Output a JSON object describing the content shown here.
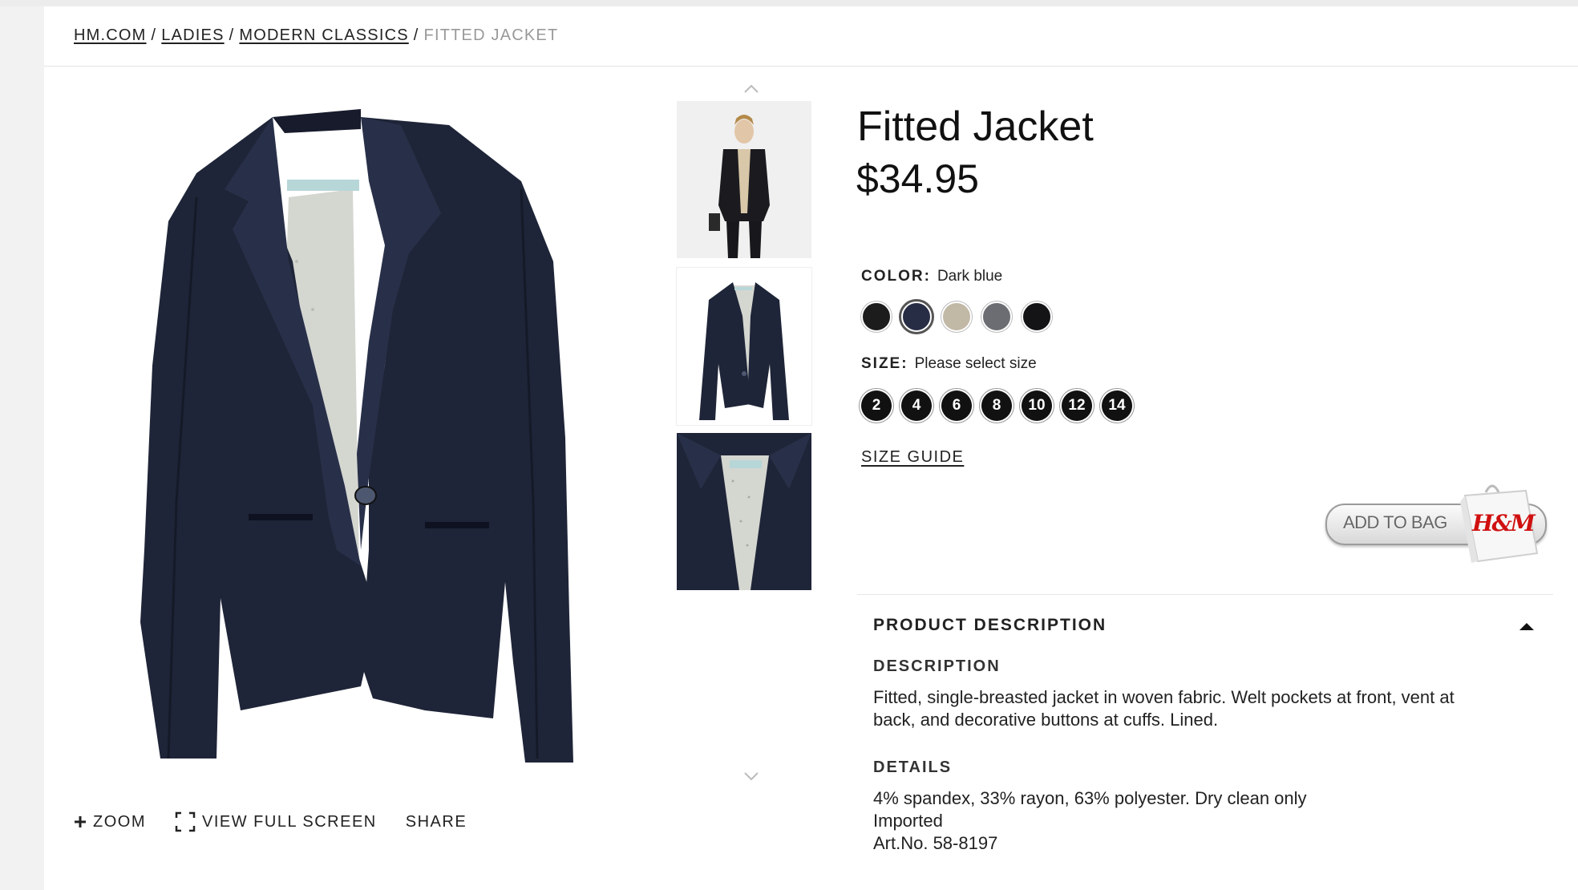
{
  "breadcrumb": {
    "items": [
      "HM.COM",
      "LADIES",
      "MODERN CLASSICS"
    ],
    "separator": "/",
    "current": "FITTED JACKET"
  },
  "image_actions": {
    "zoom": "ZOOM",
    "full_screen": "VIEW FULL SCREEN",
    "share": "SHARE"
  },
  "product": {
    "title": "Fitted Jacket",
    "price": "$34.95"
  },
  "color": {
    "label": "COLOR:",
    "selected": "Dark blue",
    "swatches": [
      {
        "name": "black",
        "hex": "#1c1c1c"
      },
      {
        "name": "dark blue",
        "hex": "#272d45",
        "selected": true
      },
      {
        "name": "beige",
        "hex": "#c2b8a6"
      },
      {
        "name": "gray",
        "hex": "#6b6d72"
      },
      {
        "name": "black 2",
        "hex": "#141417"
      }
    ]
  },
  "size": {
    "label": "SIZE:",
    "prompt": "Please select size",
    "options": [
      "2",
      "4",
      "6",
      "8",
      "10",
      "12",
      "14"
    ],
    "guide": "SIZE GUIDE"
  },
  "add_to_bag": {
    "label": "ADD TO BAG",
    "logo": "H&M"
  },
  "description": {
    "heading": "PRODUCT DESCRIPTION",
    "desc_title": "DESCRIPTION",
    "desc_lines": [
      "Fitted, single-breasted jacket in woven fabric. Welt pockets at front, vent at",
      "back, and decorative buttons at cuffs. Lined."
    ],
    "details_title": "DETAILS",
    "details_lines": [
      "4% spandex, 33% rayon, 63% polyester. Dry clean only",
      "Imported",
      "Art.No. 58-8197"
    ]
  },
  "colors": {
    "jacket": "#1f2538",
    "lining": "#d4d6d0",
    "logo_red": "#d01010"
  }
}
